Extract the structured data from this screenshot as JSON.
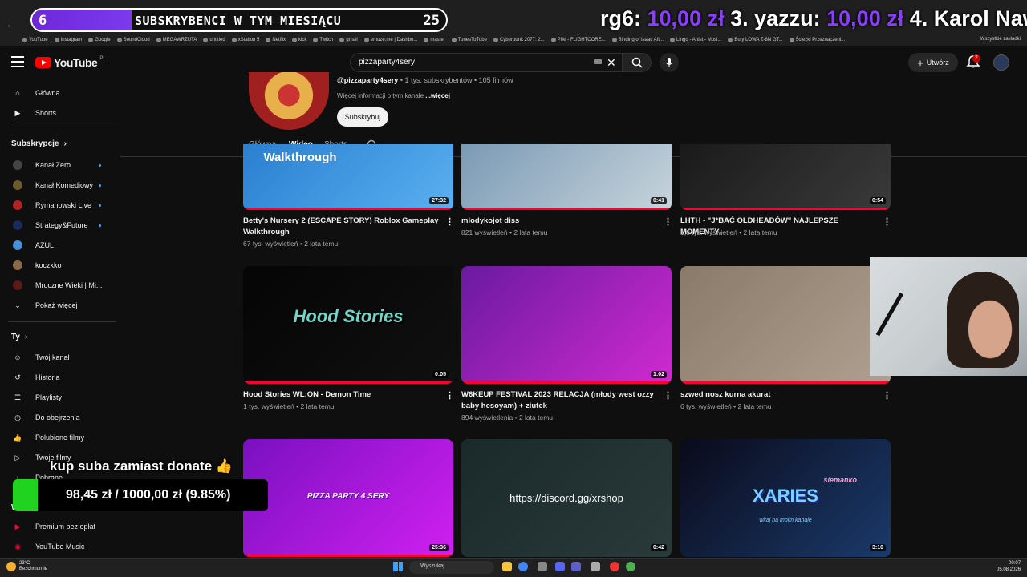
{
  "overlays": {
    "sub_count": "6",
    "sub_label": "SUBSKRYBENCI W TYM MIESIĄCU",
    "sub_goal": "25",
    "sub_progress": 0.24,
    "ticker": [
      {
        "name": "rg6: ",
        "amount": "10,00 zł "
      },
      {
        "name": "3. yazzu: ",
        "amount": "10,00 zł "
      },
      {
        "name": "4. Karol Naw",
        "amount": ""
      }
    ],
    "donate_title": "kup suba zamiast donate 👍",
    "donate_progress_text": "98,45 zł  /  1000,00 zł (9.85%)",
    "donate_progress": 0.0985
  },
  "bookmarks": [
    "YouTube",
    "Instagram",
    "Google",
    "SoundCloud",
    "MEGAWRZUTA",
    "untitled",
    "xStation 5",
    "Netflix",
    "kick",
    "Twitch",
    "gmail",
    "emuze.me | Dashbo...",
    "master",
    "TunesToTube",
    "Cyberpunk 2077: 2...",
    "Pliki - FLIGHTCORE...",
    "Binding of Isaac Aft...",
    "Lingo - Artist - Musi...",
    "Buty LOWA Z-8N GT...",
    "Ścieżki Przeznaczeni..."
  ],
  "bookmarks_all": "Wszystkie zakładki",
  "header": {
    "logo": "YouTube",
    "logo_country": "PL",
    "search_value": "pizzaparty4sery",
    "create_label": "Utwórz",
    "notifications": "2"
  },
  "sidebar": {
    "main": [
      {
        "label": "Główna",
        "icon": "home-icon"
      },
      {
        "label": "Shorts",
        "icon": "shorts-icon"
      }
    ],
    "subs_title": "Subskrypcje",
    "subs": [
      {
        "label": "Kanał Zero",
        "dot": true,
        "color": "#444444"
      },
      {
        "label": "Kanał Komediowy",
        "dot": true,
        "color": "#6b5a2a"
      },
      {
        "label": "Rymanowski Live",
        "dot": true,
        "color": "#b22222"
      },
      {
        "label": "Strategy&Future",
        "dot": true,
        "color": "#1a2a5a"
      },
      {
        "label": "AZUL",
        "dot": false,
        "color": "#4a90d9"
      },
      {
        "label": "koczkko",
        "dot": false,
        "color": "#8a6a4a"
      },
      {
        "label": "Mroczne Wieki | Mi...",
        "dot": false,
        "color": "#5a1a1a"
      }
    ],
    "show_more": "Pokaż więcej",
    "you_title": "Ty",
    "you": [
      {
        "label": "Twój kanał",
        "icon": "channel-icon"
      },
      {
        "label": "Historia",
        "icon": "history-icon"
      },
      {
        "label": "Playlisty",
        "icon": "playlist-icon"
      },
      {
        "label": "Do obejrzenia",
        "icon": "watch-later-icon"
      },
      {
        "label": "Polubione filmy",
        "icon": "like-icon"
      },
      {
        "label": "Twoje filmy",
        "icon": "your-videos-icon"
      },
      {
        "label": "Pobrane",
        "icon": "download-icon"
      }
    ],
    "more_title": "Wię",
    "premium": [
      {
        "label": "Premium bez opłat",
        "icon": "premium-icon"
      },
      {
        "label": "YouTube Music",
        "icon": "music-icon"
      }
    ]
  },
  "channel": {
    "handle": "@pizzaparty4sery",
    "stats": " • 1 tys. subskrybentów • 105 filmów",
    "more_info": "Więcej informacji o tym kanale ",
    "more_link": "...więcej",
    "subscribe": "Subskrybuj",
    "tabs": [
      "Główna",
      "Wideo",
      "Shorts"
    ],
    "active_tab": 1
  },
  "videos": [
    {
      "title": "Betty's Nursery 2 (ESCAPE STORY) Roblox Gameplay Walkthrough",
      "meta1": "67 tys. wyświetleń • 2 lata temu",
      "meta2": "",
      "duration": "27:32",
      "overlay": "Walkthrough",
      "colors": [
        "#2a7fd0",
        "#5ab0f0"
      ],
      "progress": 1
    },
    {
      "title": "mlodykojot diss",
      "meta1": "821 wyświetleń • 2 lata temu",
      "meta2": "",
      "duration": "0:41",
      "overlay": "",
      "colors": [
        "#7a9ab5",
        "#c7d4dc"
      ],
      "progress": 1
    },
    {
      "title": "LHTH - \"J*BAĆ OLDHEADÓW\" NAJLEPSZE MOMENTY",
      "meta1": "1,8 tys. wyświetleń • 2 lata temu",
      "meta2": "",
      "duration": "0:54",
      "overlay": "",
      "colors": [
        "#1a1a1a",
        "#3a3a3a"
      ],
      "progress": 1
    },
    {
      "title": "Hood Stories WL:ON - Demon Time",
      "meta1": "1 tys. wyświetleń • 2 lata temu",
      "meta2": "",
      "duration": "0:05",
      "overlay": "Hood Stories",
      "colors": [
        "#050505",
        "#101010"
      ],
      "progress": 1
    },
    {
      "title": "W6KEUP FESTIVAL 2023 RELACJA (młody west ozzy baby hesoyam) + ziutek",
      "meta1": "894 wyświetlenia • 2 lata temu",
      "meta2": "",
      "duration": "1:02",
      "overlay": "",
      "colors": [
        "#6a1aa0",
        "#d02ad0"
      ],
      "progress": 1
    },
    {
      "title": "szwed nosz kurna akurat",
      "meta1": "6 tys. wyświetleń • 2 lata temu",
      "meta2": "",
      "duration": "",
      "overlay": "",
      "colors": [
        "#8a7a6a",
        "#b0a090"
      ],
      "progress": 1
    },
    {
      "title": "",
      "meta1": "",
      "meta2": "",
      "duration": "25:36",
      "overlay": "PIZZA PARTY 4 SERY",
      "colors": [
        "#7a10c0",
        "#d020f0"
      ],
      "progress": 1
    },
    {
      "title": "",
      "meta1": "",
      "meta2": "",
      "duration": "0:42",
      "overlay": "https://discord.gg/xrshop",
      "colors": [
        "#1a2a2a",
        "#2a3a3a"
      ],
      "progress": 0
    },
    {
      "title": "",
      "meta1": "",
      "meta2": "",
      "duration": "3:10",
      "overlay": "XARIES",
      "colors": [
        "#0a0a1a",
        "#1a3a6a"
      ],
      "progress": 0
    }
  ],
  "thumb_subtexts": {
    "xaries_top": "siemanko",
    "xaries_bottom": "witaj na moim kanale"
  },
  "taskbar": {
    "temp": "23°C",
    "weather": "Bezchmurnie",
    "search": "Wyszukaj",
    "time": "00:07",
    "date": "05.08.2026"
  }
}
